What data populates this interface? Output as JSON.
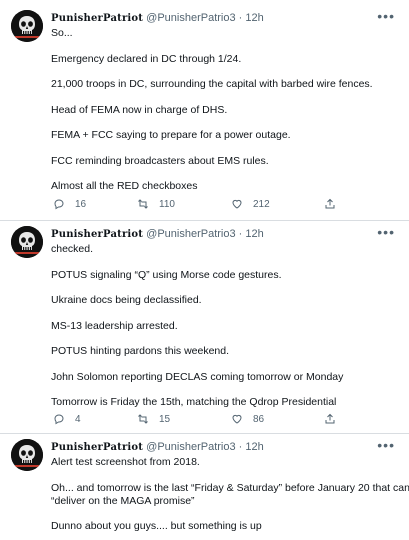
{
  "tweets": [
    {
      "name": "PunisherPatriot",
      "handle": "@PunisherPatrio3",
      "dot": "·",
      "time": "12h",
      "more": "•••",
      "lines": [
        "So...",
        "",
        "Emergency declared in DC through 1/24.",
        "",
        "21,000 troops in DC, surrounding the capital with barbed wire fences.",
        "",
        "Head of FEMA now in charge of DHS.",
        "",
        "FEMA + FCC saying to prepare for a power outage.",
        "",
        "FCC reminding broadcasters about EMS rules.",
        "",
        "Almost all the RED checkboxes"
      ],
      "replies": "16",
      "retweets": "110",
      "likes": "212"
    },
    {
      "name": "PunisherPatriot",
      "handle": "@PunisherPatrio3",
      "dot": "·",
      "time": "12h",
      "more": "•••",
      "lines": [
        "checked.",
        "",
        "POTUS signaling “Q” using Morse code gestures.",
        "",
        "Ukraine docs being declassified.",
        "",
        "MS-13 leadership arrested.",
        "",
        "POTUS hinting pardons this weekend.",
        "",
        "John Solomon reporting DECLAS coming tomorrow or Monday",
        "",
        "Tomorrow is Friday the 15th, matching the Qdrop Presidential"
      ],
      "replies": "4",
      "retweets": "15",
      "likes": "86"
    },
    {
      "name": "PunisherPatriot",
      "handle": "@PunisherPatrio3",
      "dot": "·",
      "time": "12h",
      "more": "•••",
      "lines": [
        "Alert test screenshot from 2018.",
        "",
        "Oh... and tomorrow is the last “Friday & Saturday” before January 20 that can",
        "“deliver on the MAGA promise”",
        "",
        "Dunno about you guys.... but something is up"
      ]
    }
  ],
  "icons": {
    "avatar": "punisher-skull-avatar",
    "reply": "reply-icon",
    "retweet": "retweet-icon",
    "like": "heart-icon",
    "share": "share-icon",
    "more": "more-icon"
  },
  "colors": {
    "text": "#0f1419",
    "secondary": "#536471",
    "divider": "#d9dde1",
    "avatar_bg": "#111111"
  }
}
